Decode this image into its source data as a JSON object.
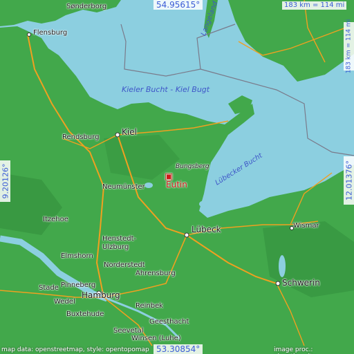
{
  "map": {
    "colors": {
      "sea": "#8ccfe0",
      "land": "#42a84b",
      "land_dark": "#2f8a3a",
      "road": "#f0a020",
      "border": "#7a7a8a"
    },
    "coordinates": {
      "top_lat": "54.95615°",
      "bottom_lat": "53.30854°",
      "left_lon": "9.20126°",
      "right_lon": "12.01376°"
    },
    "scale": {
      "horizontal": "183 km = 114 mi",
      "vertical": "183 km = 114 mi"
    },
    "marker": {
      "icon": "square-marker-icon",
      "label": "Eutin"
    },
    "water_labels": {
      "kieler_bucht": "Kieler Bucht - Kiel Bugt",
      "luebecker_bucht": "Lübecker Bucht",
      "langeland": "Langeland"
    },
    "places": {
      "sonderborg": "Sønderborg",
      "flensburg": "Flensburg",
      "kiel": "Kiel",
      "rendsburg": "Rendsburg",
      "bungsberg": "Bungsberg",
      "neumuenster": "Neumünster",
      "itzehoe": "Itzehoe",
      "luebeck": "Lübeck",
      "wismar": "Wismar",
      "henstedt_ulzburg": "Henstedt-\nUlzburg",
      "elmshorn": "Elmshorn",
      "norderstedt": "Norderstedt",
      "ahrensburg": "Ahrensburg",
      "schwerin": "Schwerin",
      "stade": "Stade",
      "pinneberg": "Pinneberg",
      "hamburg": "Hamburg",
      "wedel": "Wedel",
      "reinbek": "Reinbek",
      "buxtehude": "Buxtehude",
      "geesthacht": "Geesthacht",
      "seevetal": "Seevetal",
      "winsen": "Winsen (Luhe)"
    },
    "credits": {
      "left": "map data: openstreetmap, style: opentopomap",
      "right": "image proc.: elevation.city"
    }
  }
}
